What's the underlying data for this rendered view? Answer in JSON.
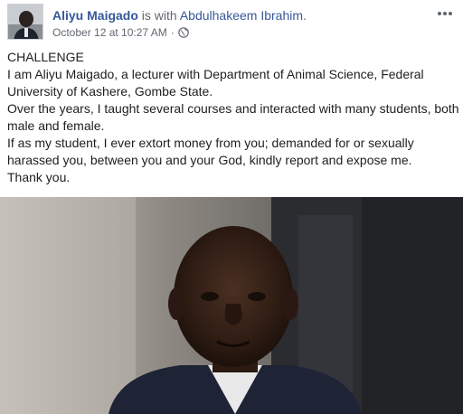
{
  "post": {
    "author": "Aliyu Maigado",
    "with_text": "is with",
    "tagged": "Abdulhakeem Ibrahim",
    "tagged_suffix": ".",
    "timestamp": "October 12 at 10:27 AM",
    "separator": "·",
    "privacy_icon": "globe-icon",
    "more_icon": "more-options-icon",
    "body_lines": [
      "CHALLENGE",
      "I am Aliyu Maigado, a lecturer with Department of Animal Science, Federal University of Kashere, Gombe State.",
      "Over the years, I taught several courses and interacted with many students, both male and female.",
      "If as my student, I ever extort money from you; demanded for or sexually harassed you, between you and your God, kindly report and expose me.",
      "Thank you."
    ],
    "photo": "portrait-photo"
  },
  "colors": {
    "link": "#365899",
    "meta": "#616770",
    "text": "#1c1e21"
  }
}
